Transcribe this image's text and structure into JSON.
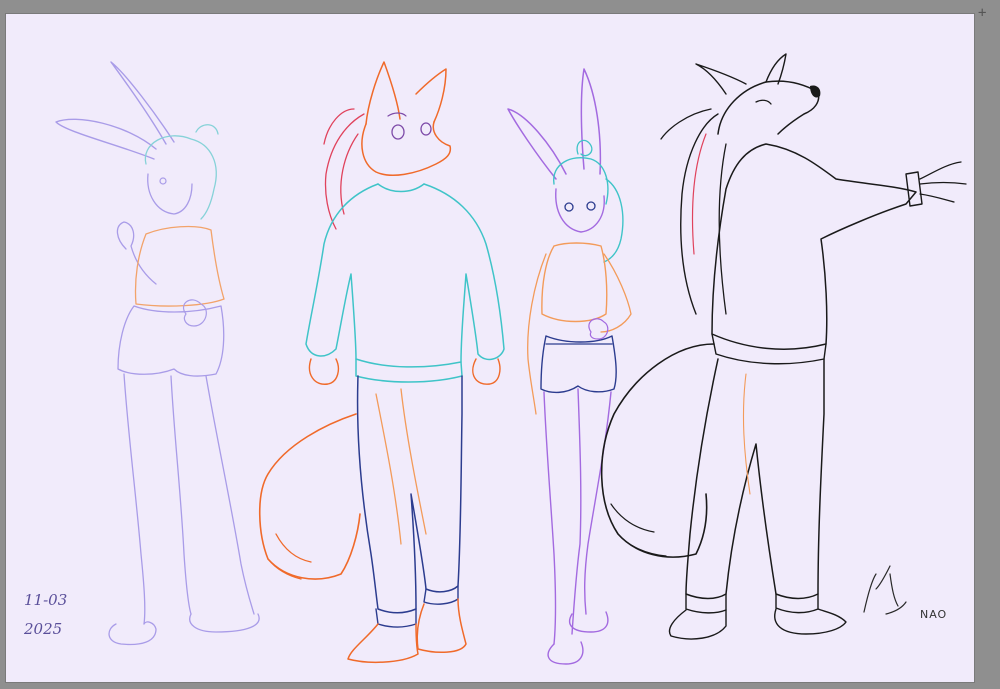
{
  "canvas": {
    "background": "#f1ebfb",
    "workspace": "#8f8f8f"
  },
  "corner_marker": "+",
  "annotations": {
    "date_line1": "11-03",
    "date_line2": "2025",
    "signature": "NAO"
  },
  "palette": {
    "bunny_sketch": "#9b8ee6",
    "bunny_hair": "#7fd4d9",
    "shirt_orange": "#f39b5a",
    "sweater_cyan": "#3fc4c8",
    "pants_blue": "#2c3c8f",
    "fox_orange": "#f06a2a",
    "fox_hair_red": "#e0425c",
    "bunny2_purple": "#a36ae0",
    "wolf_black": "#1a1a1a"
  }
}
